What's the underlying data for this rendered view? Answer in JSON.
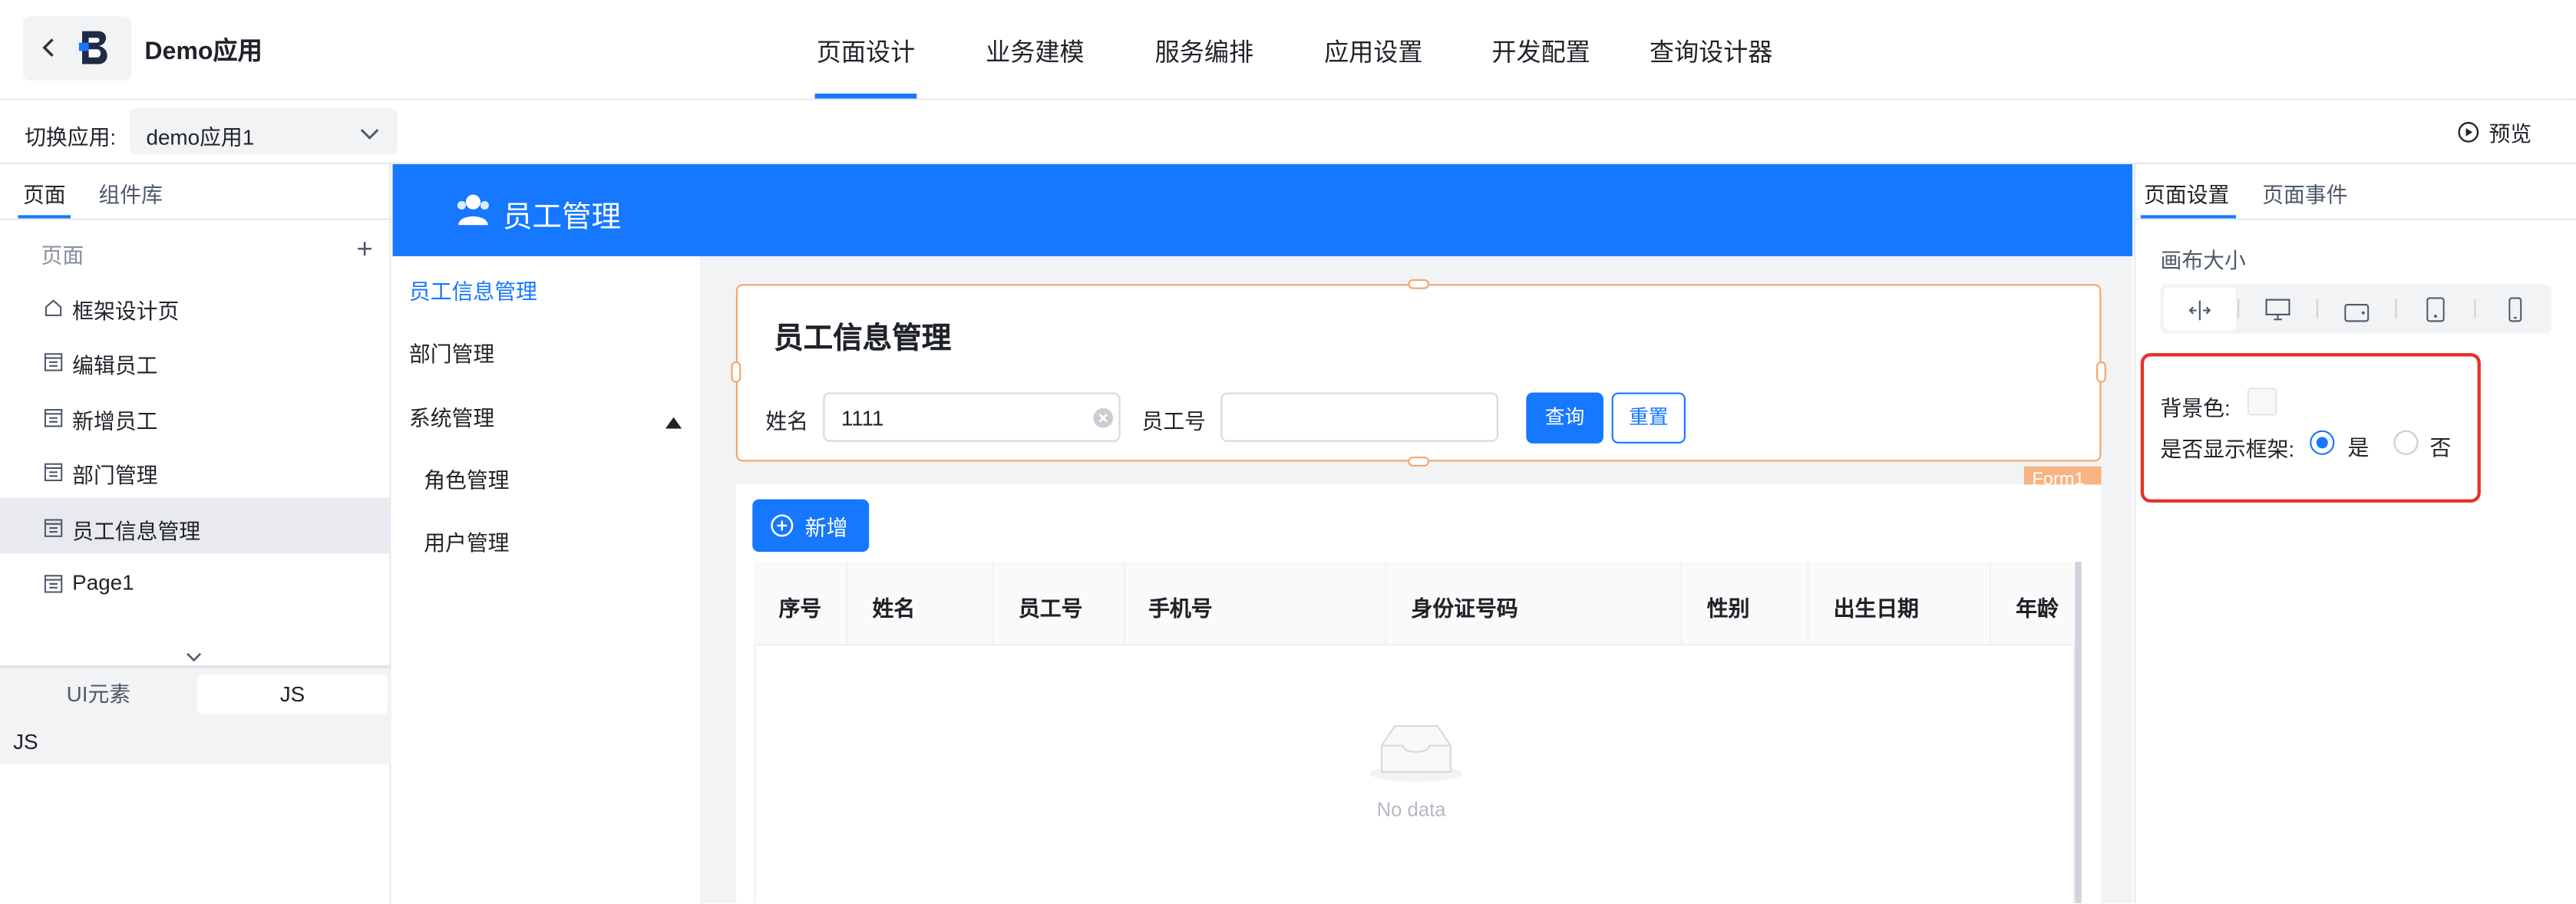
{
  "header": {
    "app_name": "Demo应用",
    "tabs": [
      {
        "label": "页面设计"
      },
      {
        "label": "业务建模"
      },
      {
        "label": "服务编排"
      },
      {
        "label": "应用设置"
      },
      {
        "label": "开发配置"
      },
      {
        "label": "查询设计器"
      }
    ]
  },
  "toolbar": {
    "switch_label": "切换应用:",
    "app_select": "demo应用1",
    "preview_label": "预览"
  },
  "left_panel": {
    "tabs": [
      {
        "label": "页面"
      },
      {
        "label": "组件库"
      }
    ],
    "section_label": "页面",
    "pages": [
      {
        "label": "框架设计页"
      },
      {
        "label": "编辑员工"
      },
      {
        "label": "新增员工"
      },
      {
        "label": "部门管理"
      },
      {
        "label": "员工信息管理"
      },
      {
        "label": "Page1"
      }
    ],
    "bottom_tabs": [
      {
        "label": "UI元素"
      },
      {
        "label": "JS"
      }
    ],
    "js_label": "JS"
  },
  "canvas": {
    "header_title": "员工管理",
    "menu": [
      {
        "label": "员工信息管理"
      },
      {
        "label": "部门管理"
      },
      {
        "label": "系统管理"
      },
      {
        "label": "角色管理"
      },
      {
        "label": "用户管理"
      }
    ],
    "form": {
      "title": "员工信息管理",
      "name_label": "姓名",
      "name_value": "1111",
      "empno_label": "员工号",
      "empno_value": "",
      "query_button": "查询",
      "reset_button": "重置",
      "tag": "Form1"
    },
    "table": {
      "add_button": "新增",
      "columns": [
        "序号",
        "姓名",
        "员工号",
        "手机号",
        "身份证号码",
        "性别",
        "出生日期",
        "年龄"
      ],
      "empty_text": "No data"
    }
  },
  "right_panel": {
    "tabs": [
      {
        "label": "页面设置"
      },
      {
        "label": "页面事件"
      }
    ],
    "canvas_size_label": "画布大小",
    "bg_color_label": "背景色:",
    "show_frame_label": "是否显示框架:",
    "yes_label": "是",
    "no_label": "否",
    "show_frame_value": "是",
    "accent_color": "#1677ff",
    "highlight_color": "#e5302a"
  }
}
